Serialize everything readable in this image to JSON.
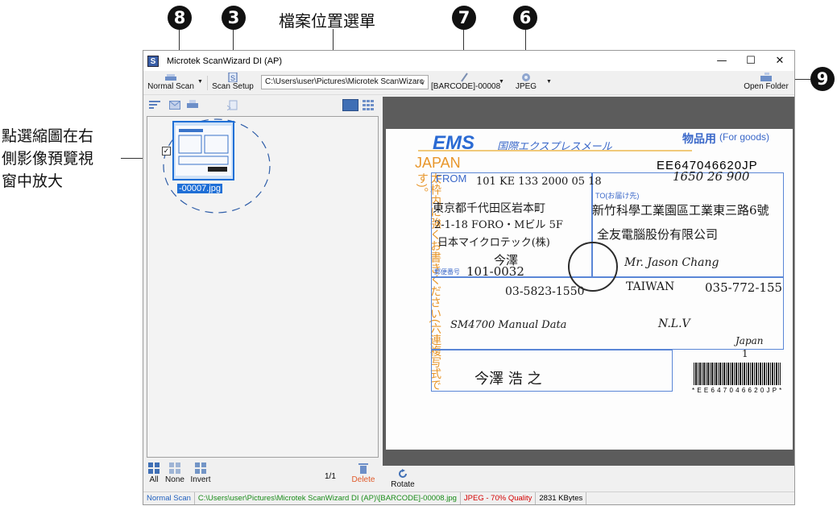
{
  "callouts": {
    "b8": "8",
    "b3": "3",
    "b7": "7",
    "b6": "6",
    "b9": "9",
    "path_menu_label": "檔案位置選單",
    "thumb_note_line1": "點選縮圖在右",
    "thumb_note_line2": "側影像預覽視",
    "thumb_note_line3": "窗中放大"
  },
  "window": {
    "title": "Microtek ScanWizard DI (AP)",
    "app_icon": "S",
    "minimize": "—",
    "maximize": "☐",
    "close": "✕"
  },
  "toolbar": {
    "normal_scan": "Normal Scan",
    "scan_setup": "Scan Setup",
    "path_value": "C:\\Users\\user\\Pictures\\Microtek ScanWizarc",
    "barcode": "[BARCODE]-00008",
    "format": "JPEG",
    "open_folder": "Open Folder"
  },
  "left_panel": {
    "thumbnail_filename": "-00007.jpg",
    "page_count": "1/1",
    "all": "All",
    "none": "None",
    "invert": "Invert",
    "delete": "Delete"
  },
  "preview": {
    "rotate": "Rotate",
    "doc": {
      "ems": "EMS",
      "ems_sub": "国際エクスプレスメール",
      "goods": "物品用",
      "goods_en": "(For goods)",
      "japan": "JAPAN",
      "tracking": "EE647046620JP",
      "from": "FROM",
      "to": "TO(お届け先)",
      "postal_code_label": "郵便番号",
      "sender_addr1": "東京都千代田区岩本町",
      "sender_addr2": "2-1-18  FORO・Mビル 5F",
      "sender_addr3": "日本マイクロテック(株)",
      "sender_name": "今澤",
      "sender_postal": "101-0032",
      "sender_tel": "03-5823-1550",
      "recv_addr1": "新竹科學工業園區工業東三路6號",
      "recv_addr2": "全友電腦股份有限公司",
      "recv_name": "Mr. Jason Chang",
      "recv_country": "TAIWAN",
      "recv_tel": "035-772-155",
      "contents": "SM4700 Manual Data",
      "nlv": "N.L.V",
      "country_origin": "Japan",
      "qty": "1",
      "signature": "今澤 浩 之",
      "barcode_text": "* E E 6 4 7 0 4 6 6 2 0 J P *",
      "side_text": "太枠内に強くお書きください(六連複写式です)。",
      "date_written": "101 KE 133 2000 05 18",
      "weight": "1650 26 900"
    }
  },
  "statusbar": {
    "mode": "Normal Scan",
    "path": "C:\\Users\\user\\Pictures\\Microtek ScanWizard DI (AP)\\[BARCODE]-00008.jpg",
    "quality": "JPEG - 70% Quality",
    "size": "2831 KBytes"
  },
  "colors": {
    "accent_blue": "#1f5fbf",
    "quality_red": "#d40000",
    "status_green": "#1a8c1a",
    "delete_orange": "#e05a2a"
  }
}
